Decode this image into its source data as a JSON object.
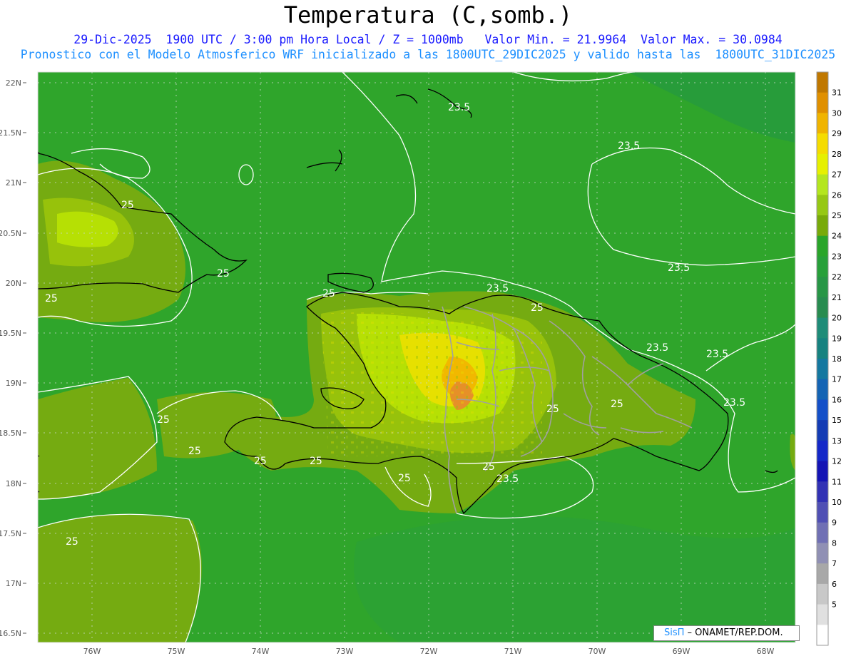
{
  "header": {
    "title": "Temperatura (C,somb.)",
    "line1": "29-Dic-2025  1900 UTC / 3:00 pm Hora Local / Z = 1000mb   Valor Min. = 21.9964  Valor Max. = 30.0984",
    "line2": "Pronostico con el Modelo Atmosferico WRF inicializado a las 1800UTC_29DIC2025 y valido hasta las  1800UTC_31DIC2025"
  },
  "colors": {
    "base_green": "#2fa52b",
    "zone_25": "#75ab11",
    "zone_26": "#97c20b",
    "zone_27": "#b6e004",
    "zone_28": "#e6e000",
    "zone_29": "#f1b800",
    "zone_30": "#e69028",
    "dark_green": "#279c3a",
    "contour": "#ffffff",
    "coast": "#000000",
    "border": "#a0a0a0"
  },
  "map": {
    "lat_labels": [
      "22N",
      "21.5N",
      "21N",
      "20.5N",
      "20N",
      "19.5N",
      "19N",
      "18.5N",
      "18N",
      "17.5N",
      "17N",
      "16.5N"
    ],
    "lon_labels": [
      "76W",
      "75W",
      "74W",
      "73W",
      "72W",
      "71W",
      "70W",
      "69W",
      "68W"
    ],
    "contour_labels": [
      {
        "text": "23.5",
        "id": "c1"
      },
      {
        "text": "23.5",
        "id": "c2"
      },
      {
        "text": "23.5",
        "id": "c3"
      },
      {
        "text": "23.5",
        "id": "c4"
      },
      {
        "text": "23.5",
        "id": "c5"
      },
      {
        "text": "23.5",
        "id": "c6"
      },
      {
        "text": "23.5",
        "id": "c7"
      },
      {
        "text": "23.5",
        "id": "c8"
      },
      {
        "text": "25",
        "id": "c9"
      },
      {
        "text": "25",
        "id": "c10"
      },
      {
        "text": "25",
        "id": "c11"
      },
      {
        "text": "25",
        "id": "c12"
      },
      {
        "text": "25",
        "id": "c13"
      },
      {
        "text": "25",
        "id": "c14"
      },
      {
        "text": "25",
        "id": "c15"
      },
      {
        "text": "25",
        "id": "c16"
      },
      {
        "text": "25",
        "id": "c17"
      },
      {
        "text": "25",
        "id": "c18"
      },
      {
        "text": "25",
        "id": "c19"
      },
      {
        "text": "25",
        "id": "c20"
      },
      {
        "text": "25",
        "id": "c21"
      },
      {
        "text": "25",
        "id": "c22"
      }
    ]
  },
  "colorbar": {
    "labels": [
      "31",
      "30",
      "29",
      "28",
      "27",
      "26",
      "25",
      "24",
      "23",
      "22",
      "21",
      "20",
      "19",
      "18",
      "17",
      "16",
      "15",
      "13",
      "12",
      "11",
      "10",
      "9",
      "8",
      "7",
      "6",
      "5"
    ],
    "colors": [
      "#c07800",
      "#e09000",
      "#f0b400",
      "#f5dc00",
      "#e6f000",
      "#b4e61e",
      "#96c814",
      "#78aa0a",
      "#2aa52a",
      "#28a03a",
      "#289646",
      "#288c50",
      "#1e8c78",
      "#168280",
      "#1478a0",
      "#1464b4",
      "#1450c8",
      "#143cb4",
      "#1428c8",
      "#1414b4",
      "#3232b4",
      "#5050b4",
      "#7070b4",
      "#9090b4",
      "#a8a8a8",
      "#c8c8c8",
      "#e0e0e0",
      "#ffffff"
    ]
  },
  "credit": {
    "brand": "SisΠ",
    "text": " – ONAMET/REP.DOM."
  }
}
